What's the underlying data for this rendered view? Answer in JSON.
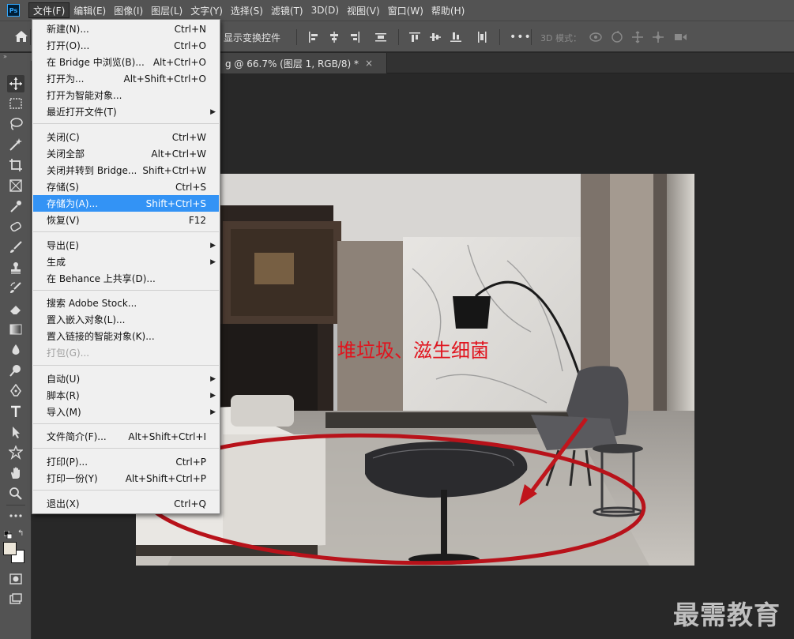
{
  "app": {
    "logo_text": "Ps"
  },
  "menubar": {
    "items": [
      "文件(F)",
      "编辑(E)",
      "图像(I)",
      "图层(L)",
      "文字(Y)",
      "选择(S)",
      "滤镜(T)",
      "3D(D)",
      "视图(V)",
      "窗口(W)",
      "帮助(H)"
    ]
  },
  "options": {
    "show_transform": "显示变换控件",
    "more": "•••",
    "mode3d": "3D 模式："
  },
  "document": {
    "tab_title": "g @ 66.7% (图层 1, RGB/8) *",
    "close": "×"
  },
  "panel_grip": "»",
  "file_menu": {
    "items": [
      {
        "label": "新建(N)...",
        "shortcut": "Ctrl+N"
      },
      {
        "label": "打开(O)...",
        "shortcut": "Ctrl+O"
      },
      {
        "label": "在 Bridge 中浏览(B)...",
        "shortcut": "Alt+Ctrl+O"
      },
      {
        "label": "打开为...",
        "shortcut": "Alt+Shift+Ctrl+O"
      },
      {
        "label": "打开为智能对象...",
        "shortcut": ""
      },
      {
        "label": "最近打开文件(T)",
        "shortcut": "",
        "submenu": true
      },
      {
        "label": "关闭(C)",
        "shortcut": "Ctrl+W"
      },
      {
        "label": "关闭全部",
        "shortcut": "Alt+Ctrl+W"
      },
      {
        "label": "关闭并转到 Bridge...",
        "shortcut": "Shift+Ctrl+W"
      },
      {
        "label": "存储(S)",
        "shortcut": "Ctrl+S"
      },
      {
        "label": "存储为(A)...",
        "shortcut": "Shift+Ctrl+S",
        "highlighted": true
      },
      {
        "label": "恢复(V)",
        "shortcut": "F12"
      },
      {
        "label": "导出(E)",
        "shortcut": "",
        "submenu": true
      },
      {
        "label": "生成",
        "shortcut": "",
        "submenu": true
      },
      {
        "label": "在 Behance 上共享(D)...",
        "shortcut": ""
      },
      {
        "label": "搜索 Adobe Stock...",
        "shortcut": ""
      },
      {
        "label": "置入嵌入对象(L)...",
        "shortcut": ""
      },
      {
        "label": "置入链接的智能对象(K)...",
        "shortcut": ""
      },
      {
        "label": "打包(G)...",
        "shortcut": "",
        "disabled": true
      },
      {
        "label": "自动(U)",
        "shortcut": "",
        "submenu": true
      },
      {
        "label": "脚本(R)",
        "shortcut": "",
        "submenu": true
      },
      {
        "label": "导入(M)",
        "shortcut": "",
        "submenu": true
      },
      {
        "label": "文件简介(F)...",
        "shortcut": "Alt+Shift+Ctrl+I"
      },
      {
        "label": "打印(P)...",
        "shortcut": "Ctrl+P"
      },
      {
        "label": "打印一份(Y)",
        "shortcut": "Alt+Shift+Ctrl+P"
      },
      {
        "label": "退出(X)",
        "shortcut": "Ctrl+Q"
      }
    ],
    "submenu_arrow": "▶"
  },
  "canvas": {
    "annotation": "堆垃圾、滋生细菌",
    "annotation_color": "#e0141e",
    "ellipse_color": "#b8121a"
  },
  "watermark": "最需教育",
  "colors": {
    "foreground": "#ece6d9",
    "background": "#ffffff",
    "highlight": "#3393f5"
  },
  "toolbar": {
    "tools": [
      "move-tool-icon",
      "marquee-tool-icon",
      "lasso-tool-icon",
      "magic-wand-icon",
      "crop-tool-icon",
      "frame-tool-icon",
      "eyedropper-icon",
      "healing-brush-icon",
      "brush-tool-icon",
      "clone-stamp-icon",
      "history-brush-icon",
      "eraser-tool-icon",
      "gradient-tool-icon",
      "blur-tool-icon",
      "dodge-tool-icon",
      "pen-tool-icon",
      "type-tool-icon",
      "path-select-icon",
      "shape-tool-icon",
      "hand-tool-icon",
      "zoom-tool-icon",
      "more-tools-icon"
    ]
  }
}
